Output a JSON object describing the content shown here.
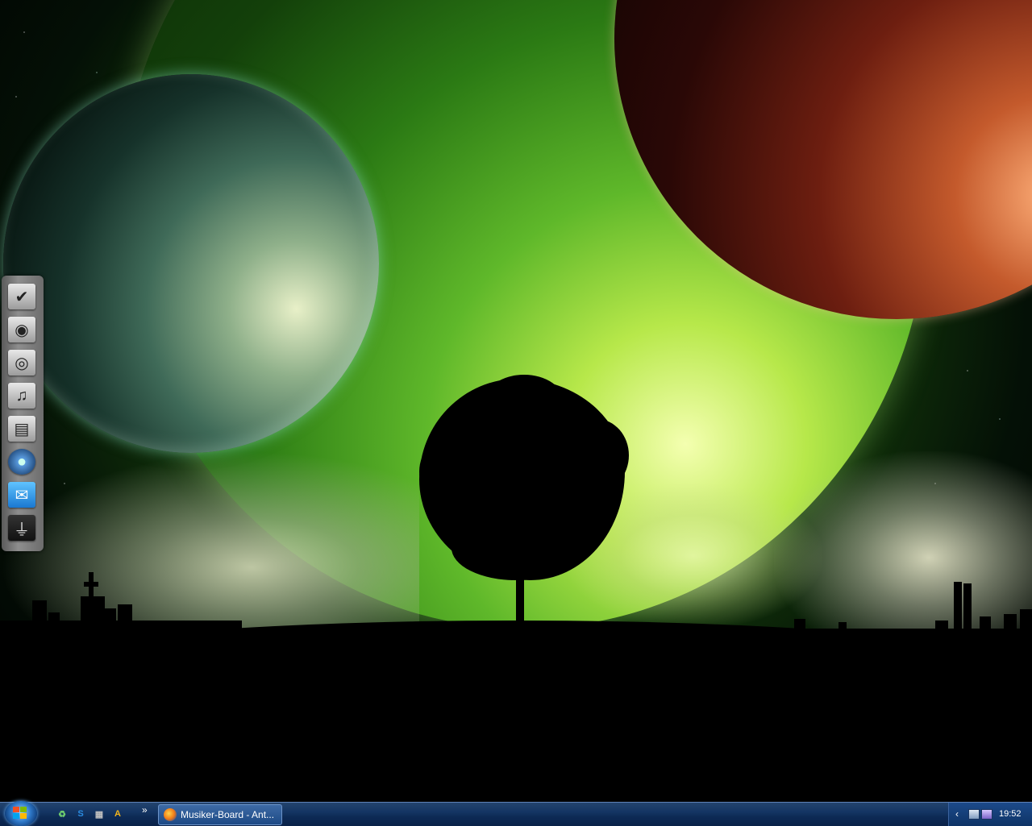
{
  "desktop": {
    "wallpaper": "wallpaper-planets-tree",
    "dock_items": [
      {
        "name": "dock-item-checkmark",
        "icon": "checkmark-icon",
        "glyph": "✔"
      },
      {
        "name": "dock-item-disc",
        "icon": "disc-icon",
        "glyph": "◉"
      },
      {
        "name": "dock-item-speaker",
        "icon": "speaker-icon",
        "glyph": "◎"
      },
      {
        "name": "dock-item-music",
        "icon": "music-note-icon",
        "glyph": "♫"
      },
      {
        "name": "dock-item-document",
        "icon": "document-icon",
        "glyph": "▤"
      },
      {
        "name": "dock-item-globe",
        "icon": "globe-icon",
        "glyph": "●"
      },
      {
        "name": "dock-item-mail",
        "icon": "mail-icon",
        "glyph": "✉"
      },
      {
        "name": "dock-item-usb",
        "icon": "usb-icon",
        "glyph": "⏚"
      }
    ]
  },
  "taskbar": {
    "start_icon": "windows-logo-icon",
    "quicklaunch": [
      {
        "name": "quicklaunch-recycle",
        "icon": "recycle-icon",
        "glyph": "♻",
        "color": "#6fcf6f"
      },
      {
        "name": "quicklaunch-skype",
        "icon": "skype-icon",
        "glyph": "S",
        "color": "#2a8be0"
      },
      {
        "name": "quicklaunch-games",
        "icon": "gamepad-icon",
        "glyph": "▦",
        "color": "#c0c0c0"
      },
      {
        "name": "quicklaunch-aim",
        "icon": "aim-icon",
        "glyph": "A",
        "color": "#f2b51c"
      }
    ],
    "overflow_label": "»",
    "tasks": [
      {
        "label": "Musiker-Board - Ant...",
        "icon": "firefox-icon"
      }
    ],
    "tray": {
      "chevron": "‹",
      "icons": [
        "network-icon",
        "volume-icon"
      ],
      "clock": "19:52"
    }
  },
  "colors": {
    "taskbar": "#143563",
    "accent": "#6bb6ff"
  }
}
